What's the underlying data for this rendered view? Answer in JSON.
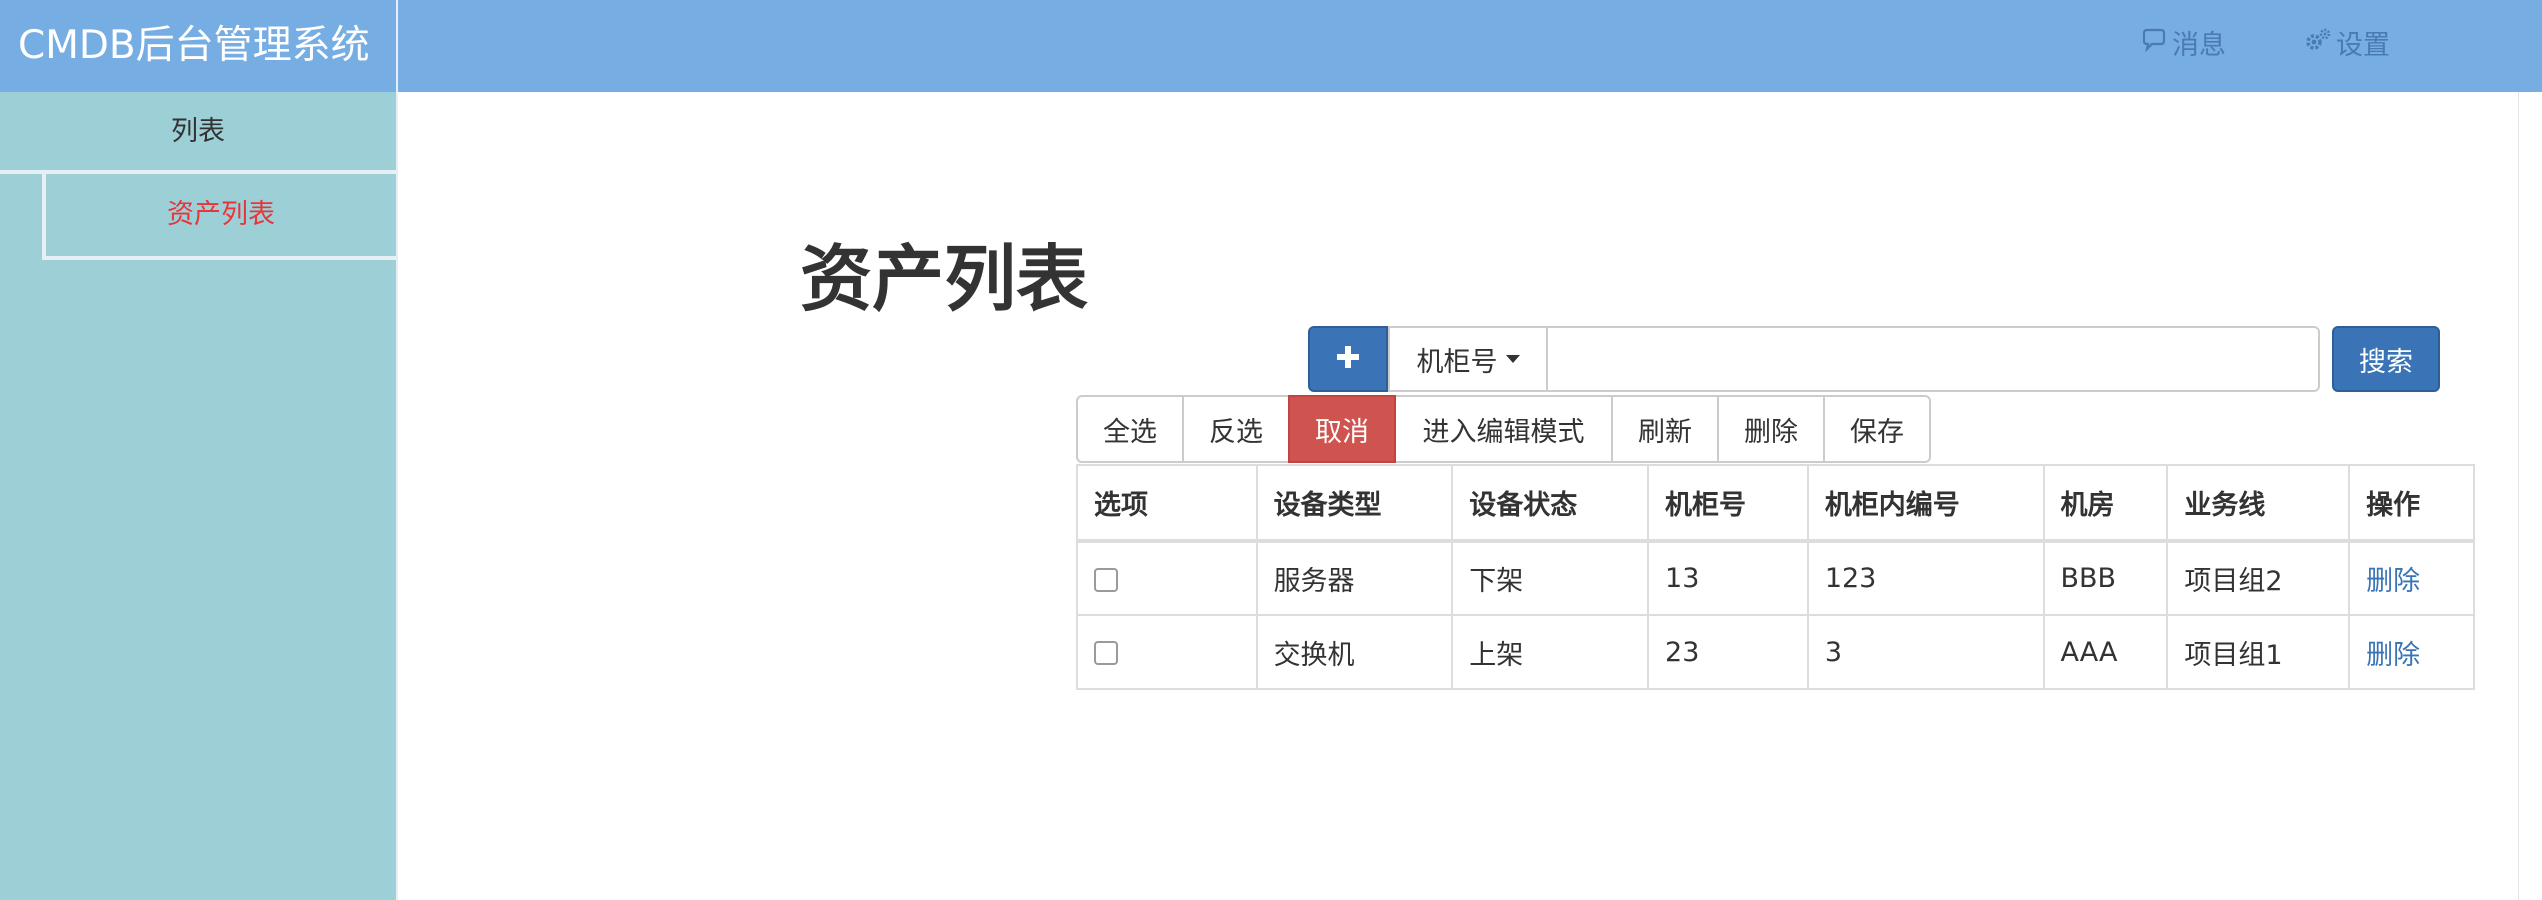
{
  "app": {
    "brand": "CMDB后台管理系统"
  },
  "header": {
    "messages_label": "消息",
    "settings_label": "设置"
  },
  "sidebar": {
    "section_title": "列表",
    "items": [
      {
        "label": "资产列表",
        "active": true
      }
    ]
  },
  "page": {
    "title": "资产列表"
  },
  "search": {
    "add_icon": "plus-icon",
    "field_selected": "机柜号",
    "value": "",
    "placeholder": "",
    "button_label": "搜索"
  },
  "toolbar": {
    "buttons": [
      {
        "label": "全选"
      },
      {
        "label": "反选"
      },
      {
        "label": "取消",
        "style": "danger"
      },
      {
        "label": "进入编辑模式"
      },
      {
        "label": "刷新"
      },
      {
        "label": "删除"
      },
      {
        "label": "保存"
      }
    ]
  },
  "table": {
    "columns": [
      "选项",
      "设备类型",
      "设备状态",
      "机柜号",
      "机柜内编号",
      "机房",
      "业务线",
      "操作"
    ],
    "rows": [
      {
        "checked": false,
        "cells": [
          "服务器",
          "下架",
          "13",
          "123",
          "BBB",
          "项目组2"
        ],
        "action": "删除"
      },
      {
        "checked": false,
        "cells": [
          "交换机",
          "上架",
          "23",
          "3",
          "AAA",
          "项目组1"
        ],
        "action": "删除"
      }
    ]
  },
  "colors": {
    "header_bg": "#76ade3",
    "sidebar_bg": "#9dcfd6",
    "active_menu_text": "#e8353a",
    "primary": "#3a74b6",
    "danger": "#cf5450",
    "link": "#3a74b6"
  }
}
